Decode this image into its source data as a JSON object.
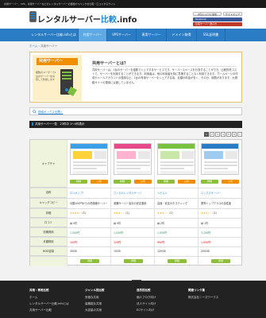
{
  "topbar": {
    "tagline": "共用サーバー、VPS、専用サーバーなどのレンタルサーバーの価格やスペックを比較・口コミするサイト"
  },
  "header": {
    "logo_main": "レンタルサーバー",
    "logo_accent": "比較",
    "logo_suffix": ".info",
    "fav_label": "お気に入りに追加",
    "sitemap_label": "サイトマップ",
    "promo1": "facebook",
    "promo2": "比較サーバー選び方"
  },
  "nav": [
    "レンタルサーバー比較.infoとは",
    "共用サーバー",
    "VPSサーバー",
    "専用サーバー",
    "ドメイン取得",
    "SSL証明書"
  ],
  "breadcrumb": {
    "home": "ホーム",
    "sep": "›",
    "current": "共用サーバー"
  },
  "card": {
    "banner_title": "共用サーバー",
    "banner_text": "複数のユーザーで1台のサーバーを共有して利用します",
    "title": "共用サーバーとは？",
    "text": "共用サーバーは、1台のサーバーを複数でシェアするサービスです。サーバースペースを分割することができ、比較的低コストで、サーバーを利用することができます。利用者は、他の利用者を特に意識することなく利用できます。ホームページの作成やメールアカウントの運用など、1台の専用サーバーをシェアする為、月額の料金が安く、その分、制限があります。大規模サイトの運用には適していません。"
  },
  "search": {
    "label": "検索ボックスを開く"
  },
  "section": {
    "title": "共用サーバー一覧　23件中 1〜4件表示"
  },
  "pager": [
    "1",
    "2",
    "3",
    "4",
    "5",
    "6",
    "»"
  ],
  "table": {
    "row_labels": [
      "キャプチャ",
      "名称",
      "キャッチコピー",
      "評価",
      "口コミ",
      "初期費用",
      "月額費用",
      "HDD容量"
    ],
    "columns": [
      {
        "name": "ロリポップ！",
        "catch": "月額100円からの低価格サーバー",
        "stars": "★★★★☆",
        "score": "(3)",
        "reviews": "0件",
        "initial": "1,500円",
        "monthly": "105円",
        "hdd": "30GB",
        "detail": "詳細",
        "site": "公式"
      },
      {
        "name": "さくらのレンタルサーバ",
        "catch": "老舗サーバー会社の安定運用",
        "stars": "★★★☆☆",
        "score": "(1)",
        "reviews": "0件",
        "initial": "1,000円",
        "monthly": "129円",
        "hdd": "10GB",
        "detail": "詳細",
        "site": "公式"
      },
      {
        "name": "ヘテムル",
        "catch": "高速・安定のホスティング",
        "stars": "★★★☆☆",
        "score": "(1)",
        "reviews": "2件",
        "initial": "1,050円",
        "monthly": "990円",
        "hdd": "120GB",
        "detail": "詳細",
        "site": "公式"
      },
      {
        "name": "エックスサーバー",
        "catch": "業界トップクラスの高性能",
        "stars": "★★★☆☆",
        "score": "(1)",
        "reviews": "1件",
        "initial": "3,150円",
        "monthly": "1,050円",
        "hdd": "200GB",
        "detail": "詳細",
        "site": "公式"
      }
    ]
  },
  "footer": {
    "pagetop": "▲",
    "cols": [
      {
        "title": "共用・専用比較",
        "items": [
          "ホーム",
          "レンタルサーバー比較.infoとは",
          "共用サーバー比較"
        ]
      },
      {
        "title": "ジャンル別比較",
        "items": [
          "安価な共用",
          "高機能な共用",
          "大容量の共用"
        ]
      },
      {
        "title": "目的別比較",
        "items": [
          "個人ブログ向け",
          "法人サイト向け",
          "ECサイト向け"
        ]
      },
      {
        "title": "関連リンク集",
        "items": [
          "株式会社ニーズワークス"
        ]
      }
    ]
  },
  "colors": {
    "nav": "#2a7cc4",
    "accent": "#ef8f00",
    "footer": "#222222"
  }
}
